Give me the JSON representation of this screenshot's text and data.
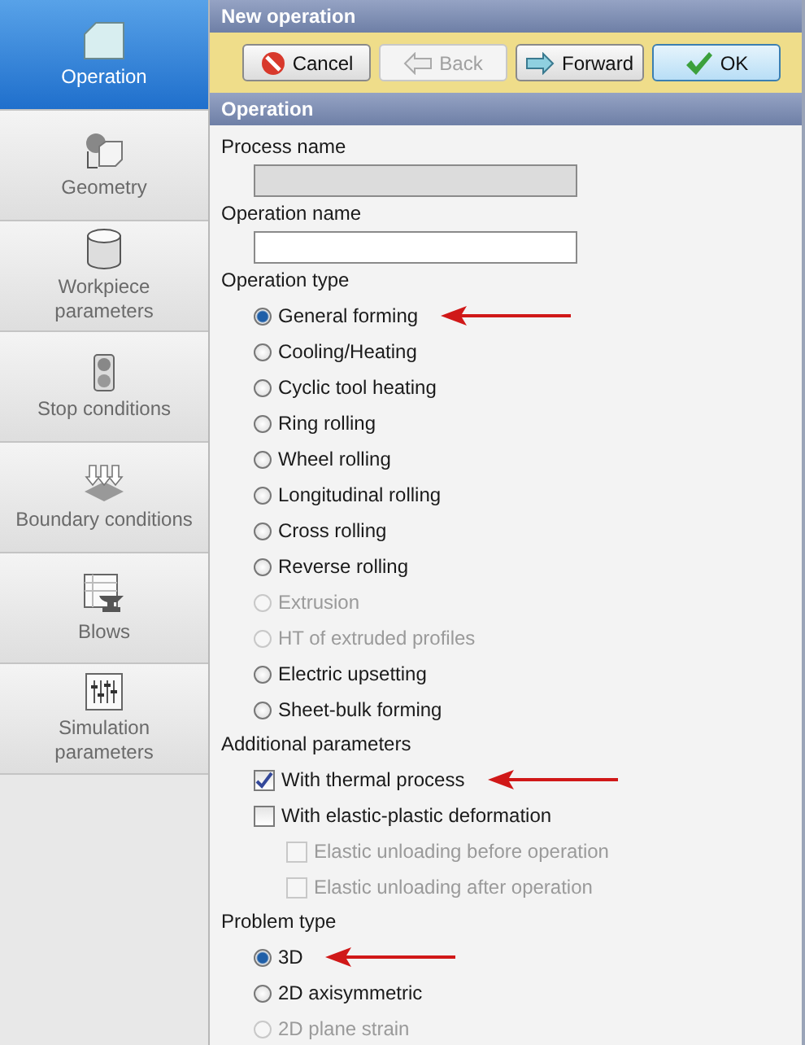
{
  "sidebar": {
    "items": [
      {
        "label": "Operation",
        "selected": true
      },
      {
        "label": "Geometry",
        "selected": false
      },
      {
        "label": "Workpiece parameters",
        "selected": false
      },
      {
        "label": "Stop conditions",
        "selected": false
      },
      {
        "label": "Boundary conditions",
        "selected": false
      },
      {
        "label": "Blows",
        "selected": false
      },
      {
        "label": "Simulation parameters",
        "selected": false
      }
    ]
  },
  "window": {
    "title": "New operation"
  },
  "toolbar": {
    "buttons": [
      {
        "label": "Cancel",
        "disabled": false,
        "default": false
      },
      {
        "label": "Back",
        "disabled": true,
        "default": false
      },
      {
        "label": "Forward",
        "disabled": false,
        "default": false
      },
      {
        "label": "OK",
        "disabled": false,
        "default": true
      }
    ]
  },
  "section": {
    "title": "Operation"
  },
  "process_name": {
    "label": "Process name",
    "disabled": true
  },
  "operation_name": {
    "label": "Operation name",
    "disabled": false
  },
  "operation_type": {
    "label": "Operation type",
    "options": [
      {
        "label": "General forming",
        "selected": true,
        "disabled": false,
        "arrow": true
      },
      {
        "label": "Cooling/Heating",
        "selected": false,
        "disabled": false,
        "arrow": false
      },
      {
        "label": "Cyclic tool heating",
        "selected": false,
        "disabled": false,
        "arrow": false
      },
      {
        "label": "Ring rolling",
        "selected": false,
        "disabled": false,
        "arrow": false
      },
      {
        "label": "Wheel rolling",
        "selected": false,
        "disabled": false,
        "arrow": false
      },
      {
        "label": "Longitudinal rolling",
        "selected": false,
        "disabled": false,
        "arrow": false
      },
      {
        "label": "Cross rolling",
        "selected": false,
        "disabled": false,
        "arrow": false
      },
      {
        "label": "Reverse rolling",
        "selected": false,
        "disabled": false,
        "arrow": false
      },
      {
        "label": "Extrusion",
        "selected": false,
        "disabled": true,
        "arrow": false
      },
      {
        "label": "HT of extruded profiles",
        "selected": false,
        "disabled": true,
        "arrow": false
      },
      {
        "label": "Electric upsetting",
        "selected": false,
        "disabled": false,
        "arrow": false
      },
      {
        "label": "Sheet-bulk forming",
        "selected": false,
        "disabled": false,
        "arrow": false
      }
    ]
  },
  "additional_parameters": {
    "label": "Additional parameters",
    "options": [
      {
        "label": "With thermal process",
        "checked": true,
        "disabled": false,
        "arrow": true
      },
      {
        "label": "With elastic-plastic deformation",
        "checked": false,
        "disabled": false,
        "arrow": false,
        "children": [
          {
            "label": "Elastic unloading before operation",
            "checked": false,
            "disabled": true,
            "arrow": false
          },
          {
            "label": "Elastic unloading after operation",
            "checked": false,
            "disabled": true,
            "arrow": false
          }
        ]
      }
    ]
  },
  "problem_type": {
    "label": "Problem type",
    "options": [
      {
        "label": "3D",
        "selected": true,
        "disabled": false,
        "arrow": true
      },
      {
        "label": "2D axisymmetric",
        "selected": false,
        "disabled": false,
        "arrow": false
      },
      {
        "label": "2D plane strain",
        "selected": false,
        "disabled": true,
        "arrow": false
      }
    ]
  }
}
